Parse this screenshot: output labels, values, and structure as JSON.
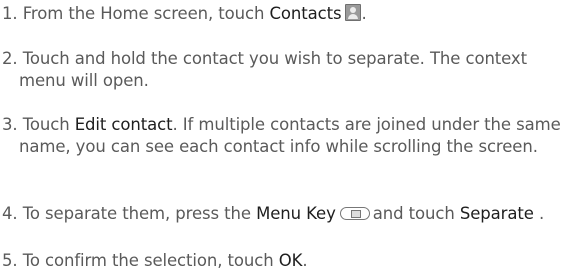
{
  "steps": [
    {
      "num": "1.",
      "a": "From the Home screen, touch",
      "b": "Contacts",
      "icon": "contacts-icon",
      "c": "."
    },
    {
      "num": "2.",
      "a": "Touch and hold the contact you wish to separate. The context menu will open."
    },
    {
      "num": "3.",
      "a": "Touch",
      "b": "Edit contact",
      "c": ". If multiple contacts are joined under the same name, you can see each contact info while scrolling the screen."
    },
    {
      "num": "4.",
      "a": "To separate them, press the",
      "b": "Menu Key",
      "icon": "menu-key-icon",
      "c": "and touch",
      "d": "Separate",
      "e": "."
    },
    {
      "num": "5.",
      "a": "To confirm the selection, touch",
      "b": "OK",
      "c": "."
    }
  ]
}
